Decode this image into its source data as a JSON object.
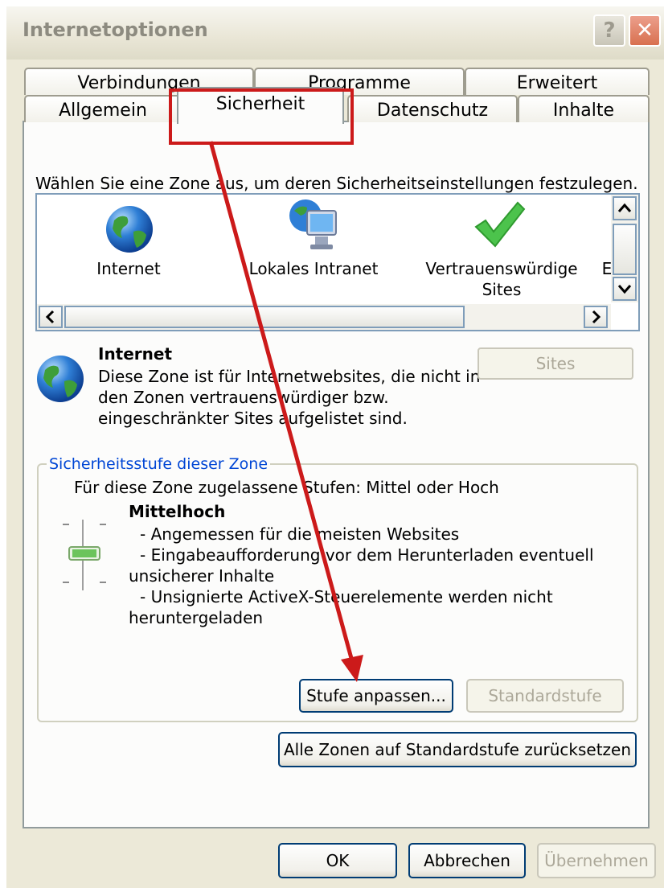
{
  "window": {
    "title": "Internetoptionen"
  },
  "tabs_row1": [
    "Verbindungen",
    "Programme",
    "Erweitert"
  ],
  "tabs_row2": [
    "Allgemein",
    "Sicherheit",
    "Datenschutz",
    "Inhalte"
  ],
  "instruction": "Wählen Sie eine Zone aus, um deren Sicherheitseinstellungen festzulegen.",
  "zones": [
    {
      "label": "Internet",
      "icon": "globe-icon"
    },
    {
      "label": "Lokales Intranet",
      "icon": "intranet-icon"
    },
    {
      "label_line1": "Vertrauenswürdige",
      "label_line2": "Sites",
      "icon": "checkmark-icon"
    },
    {
      "label": "E",
      "icon": "restricted-icon"
    }
  ],
  "zone_info": {
    "name": "Internet",
    "description": [
      "Diese Zone ist für Internetwebsites, die nicht in",
      "den Zonen vertrauenswürdiger bzw.",
      "eingeschränkter Sites aufgelistet sind."
    ],
    "sites_button": "Sites"
  },
  "security_level": {
    "group_label": "Sicherheitsstufe dieser Zone",
    "allowed": "Für diese Zone zugelassene Stufen: Mittel oder Hoch",
    "level_name": "Mittelhoch",
    "bullets": [
      "- Angemessen für die meisten Websites",
      "- Eingabeaufforderung vor dem Herunterladen eventuell",
      "unsicherer Inhalte",
      "- Unsignierte ActiveX-Steuerelemente werden nicht",
      "heruntergeladen"
    ],
    "custom_button": "Stufe anpassen...",
    "default_button": "Standardstufe"
  },
  "reset_all_button": "Alle Zonen auf Standardstufe zurücksetzen",
  "footer": {
    "ok": "OK",
    "cancel": "Abbrechen",
    "apply": "Übernehmen"
  },
  "colors": {
    "annotation": "#cc1a1a",
    "group_label": "#0046d5"
  }
}
